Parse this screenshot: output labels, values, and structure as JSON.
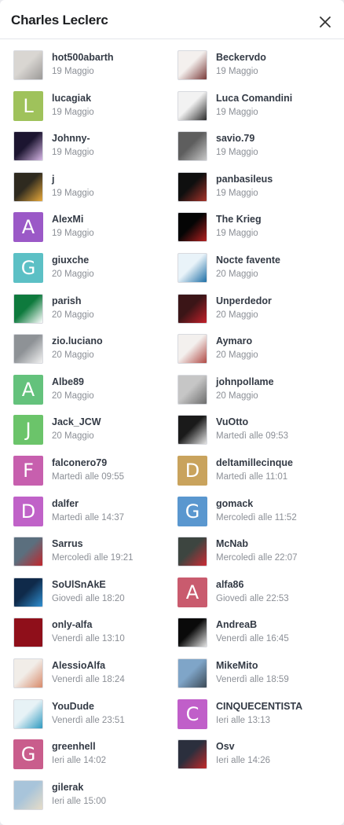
{
  "dialog": {
    "title": "Charles Leclerc",
    "close_icon": "close-icon"
  },
  "users": [
    {
      "name": "hot500abarth",
      "date": "19 Maggio",
      "avatar": {
        "type": "photo",
        "bg": "#d9d6d2",
        "accent": "#9c9a98"
      }
    },
    {
      "name": "Beckervdo",
      "date": "19 Maggio",
      "avatar": {
        "type": "photo",
        "bg": "#f4f0ee",
        "accent": "#7a3b3a"
      }
    },
    {
      "name": "lucagiak",
      "date": "19 Maggio",
      "avatar": {
        "type": "letter",
        "letter": "L",
        "bg": "#9fc25b"
      }
    },
    {
      "name": "Luca Comandini",
      "date": "19 Maggio",
      "avatar": {
        "type": "photo",
        "bg": "#f2f2f2",
        "accent": "#2b2b2b"
      }
    },
    {
      "name": "Johnny-",
      "date": "19 Maggio",
      "avatar": {
        "type": "photo",
        "bg": "#1c1530",
        "accent": "#d7b6e6"
      }
    },
    {
      "name": "savio.79",
      "date": "19 Maggio",
      "avatar": {
        "type": "photo",
        "bg": "#5e5e5e",
        "accent": "#c9c9c9"
      }
    },
    {
      "name": "j",
      "date": "19 Maggio",
      "avatar": {
        "type": "photo",
        "bg": "#2e2a1f",
        "accent": "#e8a93a"
      }
    },
    {
      "name": "panbasileus",
      "date": "19 Maggio",
      "avatar": {
        "type": "photo",
        "bg": "#0f0f0f",
        "accent": "#a8332a"
      }
    },
    {
      "name": "AlexMi",
      "date": "19 Maggio",
      "avatar": {
        "type": "letter",
        "letter": "A",
        "bg": "#9b59c7"
      }
    },
    {
      "name": "The Krieg",
      "date": "19 Maggio",
      "avatar": {
        "type": "photo",
        "bg": "#050505",
        "accent": "#b52020"
      }
    },
    {
      "name": "giuxche",
      "date": "20 Maggio",
      "avatar": {
        "type": "letter",
        "letter": "G",
        "bg": "#5cc0c5"
      }
    },
    {
      "name": "Nocte favente",
      "date": "20 Maggio",
      "avatar": {
        "type": "photo",
        "bg": "#e9f3f9",
        "accent": "#1e6fa6"
      }
    },
    {
      "name": "parish",
      "date": "20 Maggio",
      "avatar": {
        "type": "photo",
        "bg": "#0e7a3d",
        "accent": "#ffffff"
      }
    },
    {
      "name": "Unperdedor",
      "date": "20 Maggio",
      "avatar": {
        "type": "photo",
        "bg": "#3b1517",
        "accent": "#c4202a"
      }
    },
    {
      "name": "zio.luciano",
      "date": "20 Maggio",
      "avatar": {
        "type": "photo",
        "bg": "#8e9296",
        "accent": "#f2f2f2"
      }
    },
    {
      "name": "Aymaro",
      "date": "20 Maggio",
      "avatar": {
        "type": "photo",
        "bg": "#f3f0ee",
        "accent": "#b14a45"
      }
    },
    {
      "name": "Albe89",
      "date": "20 Maggio",
      "avatar": {
        "type": "letter",
        "letter": "A",
        "bg": "#64c27c"
      }
    },
    {
      "name": "johnpollame",
      "date": "20 Maggio",
      "avatar": {
        "type": "photo",
        "bg": "#c6c6c6",
        "accent": "#6d6d6d"
      }
    },
    {
      "name": "Jack_JCW",
      "date": "20 Maggio",
      "avatar": {
        "type": "letter",
        "letter": "J",
        "bg": "#6bc46a"
      }
    },
    {
      "name": "VuOtto",
      "date": "Martedì alle 09:53",
      "avatar": {
        "type": "photo",
        "bg": "#1a1a1a",
        "accent": "#e5e5e5"
      }
    },
    {
      "name": "falconero79",
      "date": "Martedì alle 09:55",
      "avatar": {
        "type": "letter",
        "letter": "F",
        "bg": "#c75fae"
      }
    },
    {
      "name": "deltamillecinque",
      "date": "Martedì alle 11:01",
      "avatar": {
        "type": "letter",
        "letter": "D",
        "bg": "#c9a35d"
      }
    },
    {
      "name": "dalfer",
      "date": "Martedì alle 14:37",
      "avatar": {
        "type": "letter",
        "letter": "D",
        "bg": "#c062c8"
      }
    },
    {
      "name": "gomack",
      "date": "Mercoledì alle 11:52",
      "avatar": {
        "type": "letter",
        "letter": "G",
        "bg": "#5a97cf"
      }
    },
    {
      "name": "Sarrus",
      "date": "Mercoledì alle 19:21",
      "avatar": {
        "type": "photo",
        "bg": "#5b6f7e",
        "accent": "#c2262c"
      }
    },
    {
      "name": "McNab",
      "date": "Mercoledì alle 22:07",
      "avatar": {
        "type": "photo",
        "bg": "#3d4540",
        "accent": "#cc2b35"
      }
    },
    {
      "name": "SoUlSnAkE",
      "date": "Giovedì alle 18:20",
      "avatar": {
        "type": "photo",
        "bg": "#0f2a4a",
        "accent": "#2f8fd1"
      }
    },
    {
      "name": "alfa86",
      "date": "Giovedì alle 22:53",
      "avatar": {
        "type": "letter",
        "letter": "A",
        "bg": "#c95b6e"
      }
    },
    {
      "name": "only-alfa",
      "date": "Venerdì alle 13:10",
      "avatar": {
        "type": "photo",
        "bg": "#8f0f1a",
        "accent": "#8f0f1a"
      }
    },
    {
      "name": "AndreaB",
      "date": "Venerdì alle 16:45",
      "avatar": {
        "type": "photo",
        "bg": "#0a0a0a",
        "accent": "#e5e5e5"
      }
    },
    {
      "name": "AlessioAlfa",
      "date": "Venerdì alle 18:24",
      "avatar": {
        "type": "photo",
        "bg": "#f1ede8",
        "accent": "#d88a6a"
      }
    },
    {
      "name": "MikeMito",
      "date": "Venerdì alle 18:59",
      "avatar": {
        "type": "photo",
        "bg": "#7fa5c8",
        "accent": "#3d4b57"
      }
    },
    {
      "name": "YouDude",
      "date": "Venerdì alle 23:51",
      "avatar": {
        "type": "photo",
        "bg": "#e7f2f6",
        "accent": "#2e9ac0"
      }
    },
    {
      "name": "CINQUECENTISTA",
      "date": "Ieri alle 13:13",
      "avatar": {
        "type": "letter",
        "letter": "C",
        "bg": "#c05fc9"
      }
    },
    {
      "name": "greenhell",
      "date": "Ieri alle 14:02",
      "avatar": {
        "type": "letter",
        "letter": "G",
        "bg": "#c95d8c"
      }
    },
    {
      "name": "Osv",
      "date": "Ieri alle 14:26",
      "avatar": {
        "type": "photo",
        "bg": "#2b2f3d",
        "accent": "#c22a2a"
      }
    },
    {
      "name": "gilerak",
      "date": "Ieri alle 15:00",
      "avatar": {
        "type": "photo",
        "bg": "#a8c4da",
        "accent": "#e6dcc8"
      }
    }
  ]
}
